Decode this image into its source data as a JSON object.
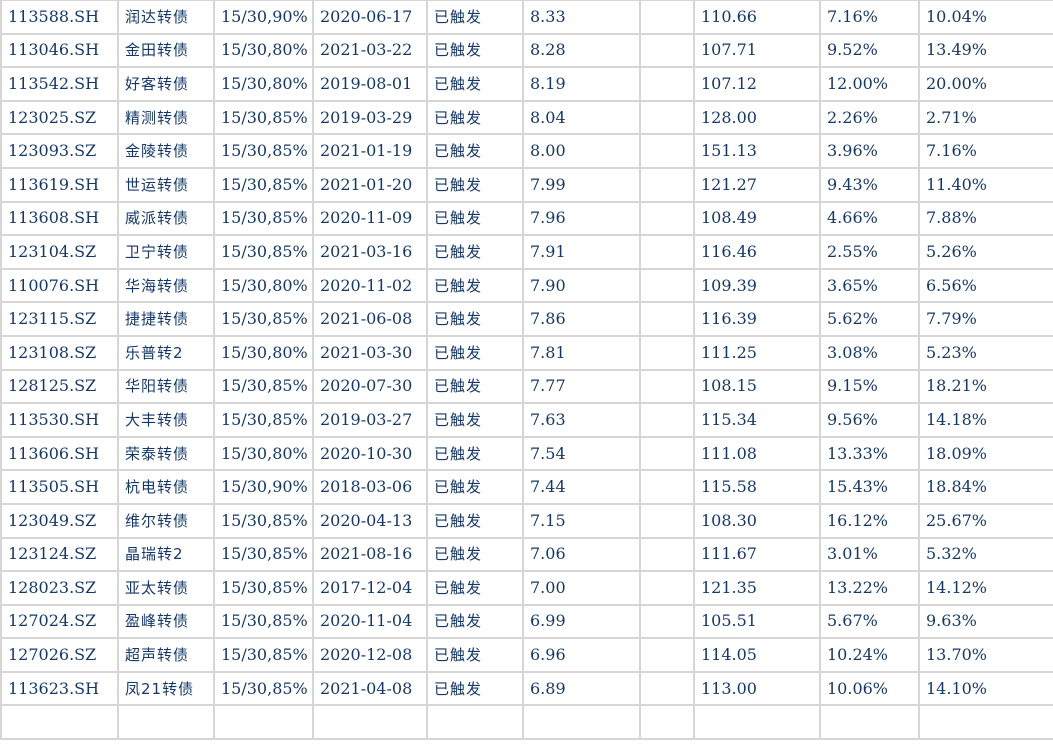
{
  "table": {
    "rows": [
      [
        "113588.SH",
        "润达转债",
        "15/30,90%",
        "2020-06-17",
        "已触发",
        "8.33",
        "",
        "110.66",
        "7.16%",
        "10.04%"
      ],
      [
        "113046.SH",
        "金田转债",
        "15/30,80%",
        "2021-03-22",
        "已触发",
        "8.28",
        "",
        "107.71",
        "9.52%",
        "13.49%"
      ],
      [
        "113542.SH",
        "好客转债",
        "15/30,80%",
        "2019-08-01",
        "已触发",
        "8.19",
        "",
        "107.12",
        "12.00%",
        "20.00%"
      ],
      [
        "123025.SZ",
        "精测转债",
        "15/30,85%",
        "2019-03-29",
        "已触发",
        "8.04",
        "",
        "128.00",
        "2.26%",
        "2.71%"
      ],
      [
        "123093.SZ",
        "金陵转债",
        "15/30,85%",
        "2021-01-19",
        "已触发",
        "8.00",
        "",
        "151.13",
        "3.96%",
        "7.16%"
      ],
      [
        "113619.SH",
        "世运转债",
        "15/30,85%",
        "2021-01-20",
        "已触发",
        "7.99",
        "",
        "121.27",
        "9.43%",
        "11.40%"
      ],
      [
        "113608.SH",
        "威派转债",
        "15/30,85%",
        "2020-11-09",
        "已触发",
        "7.96",
        "",
        "108.49",
        "4.66%",
        "7.88%"
      ],
      [
        "123104.SZ",
        "卫宁转债",
        "15/30,85%",
        "2021-03-16",
        "已触发",
        "7.91",
        "",
        "116.46",
        "2.55%",
        "5.26%"
      ],
      [
        "110076.SH",
        "华海转债",
        "15/30,80%",
        "2020-11-02",
        "已触发",
        "7.90",
        "",
        "109.39",
        "3.65%",
        "6.56%"
      ],
      [
        "123115.SZ",
        "捷捷转债",
        "15/30,85%",
        "2021-06-08",
        "已触发",
        "7.86",
        "",
        "116.39",
        "5.62%",
        "7.79%"
      ],
      [
        "123108.SZ",
        "乐普转2",
        "15/30,80%",
        "2021-03-30",
        "已触发",
        "7.81",
        "",
        "111.25",
        "3.08%",
        "5.23%"
      ],
      [
        "128125.SZ",
        "华阳转债",
        "15/30,85%",
        "2020-07-30",
        "已触发",
        "7.77",
        "",
        "108.15",
        "9.15%",
        "18.21%"
      ],
      [
        "113530.SH",
        "大丰转债",
        "15/30,85%",
        "2019-03-27",
        "已触发",
        "7.63",
        "",
        "115.34",
        "9.56%",
        "14.18%"
      ],
      [
        "113606.SH",
        "荣泰转债",
        "15/30,80%",
        "2020-10-30",
        "已触发",
        "7.54",
        "",
        "111.08",
        "13.33%",
        "18.09%"
      ],
      [
        "113505.SH",
        "杭电转债",
        "15/30,90%",
        "2018-03-06",
        "已触发",
        "7.44",
        "",
        "115.58",
        "15.43%",
        "18.84%"
      ],
      [
        "123049.SZ",
        "维尔转债",
        "15/30,85%",
        "2020-04-13",
        "已触发",
        "7.15",
        "",
        "108.30",
        "16.12%",
        "25.67%"
      ],
      [
        "123124.SZ",
        "晶瑞转2",
        "15/30,85%",
        "2021-08-16",
        "已触发",
        "7.06",
        "",
        "111.67",
        "3.01%",
        "5.32%"
      ],
      [
        "128023.SZ",
        "亚太转债",
        "15/30,85%",
        "2017-12-04",
        "已触发",
        "7.00",
        "",
        "121.35",
        "13.22%",
        "14.12%"
      ],
      [
        "127024.SZ",
        "盈峰转债",
        "15/30,85%",
        "2020-11-04",
        "已触发",
        "6.99",
        "",
        "105.51",
        "5.67%",
        "9.63%"
      ],
      [
        "127026.SZ",
        "超声转债",
        "15/30,85%",
        "2020-12-08",
        "已触发",
        "6.96",
        "",
        "114.05",
        "10.24%",
        "13.70%"
      ],
      [
        "113623.SH",
        "凤21转债",
        "15/30,85%",
        "2021-04-08",
        "已触发",
        "6.89",
        "",
        "113.00",
        "10.06%",
        "14.10%"
      ],
      [
        "",
        "",
        "",
        "",
        "",
        "",
        "",
        "",
        "",
        ""
      ]
    ]
  }
}
